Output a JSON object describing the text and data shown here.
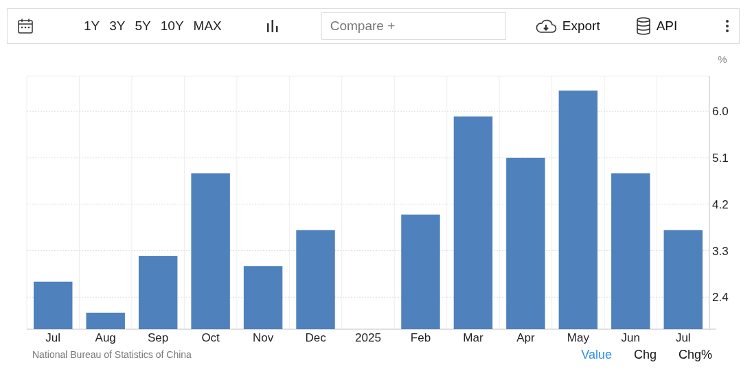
{
  "toolbar": {
    "ranges": [
      {
        "label": "1Y"
      },
      {
        "label": "3Y"
      },
      {
        "label": "5Y"
      },
      {
        "label": "10Y"
      },
      {
        "label": "MAX"
      }
    ],
    "compare": {
      "placeholder": "Compare +"
    },
    "export": "Export",
    "api": "API"
  },
  "chart": {
    "chart_data": {
      "type": "bar",
      "ylabel": "%",
      "categories": [
        "Jul",
        "Aug",
        "Sep",
        "Oct",
        "Nov",
        "Dec",
        "2025",
        "Feb",
        "Mar",
        "Apr",
        "May",
        "Jun",
        "Jul"
      ],
      "grid": true,
      "series": [
        {
          "color": "#4f81bd",
          "values": [
            2.7,
            2.1,
            3.2,
            4.8,
            3.0,
            3.7,
            null,
            4.0,
            5.9,
            5.1,
            6.4,
            4.8,
            3.7
          ]
        }
      ],
      "ylim": [
        1.78,
        6.68
      ],
      "yticks": [
        {
          "value": 2.4,
          "label": "2.4"
        },
        {
          "value": 3.3,
          "label": "3.3"
        },
        {
          "value": 4.2,
          "label": "4.2"
        },
        {
          "value": 5.1,
          "label": "5.1"
        },
        {
          "value": 6,
          "label": "6.0"
        }
      ]
    }
  },
  "source": "National Bureau of Statistics of China",
  "modes": [
    {
      "label": "Value",
      "selected": true
    },
    {
      "label": "Chg",
      "selected": false
    },
    {
      "label": "Chg%",
      "selected": false
    }
  ]
}
